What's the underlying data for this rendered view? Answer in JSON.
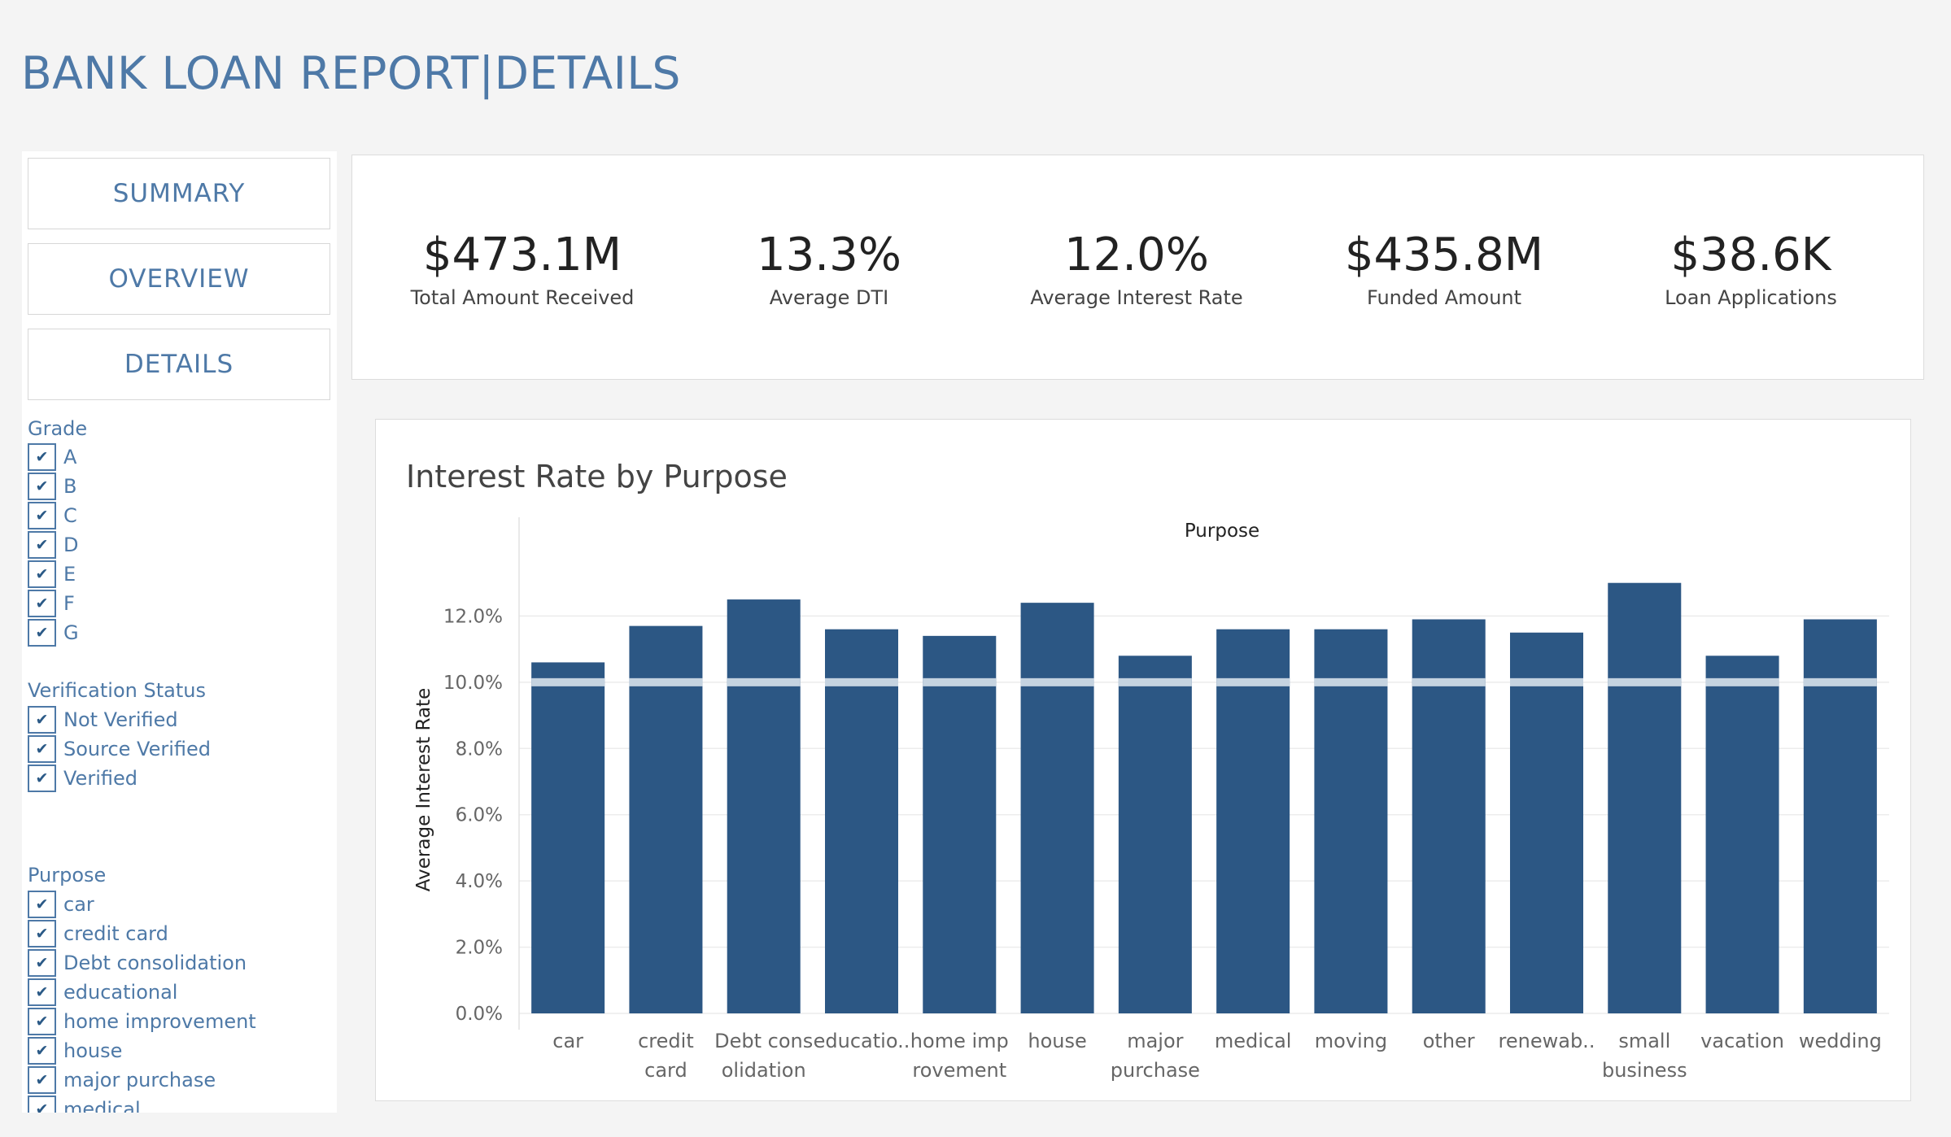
{
  "header": {
    "title": "BANK LOAN REPORT|DETAILS"
  },
  "nav": {
    "summary": "SUMMARY",
    "overview": "OVERVIEW",
    "details": "DETAILS"
  },
  "filters": {
    "grade": {
      "title": "Grade",
      "items": [
        "A",
        "B",
        "C",
        "D",
        "E",
        "F",
        "G"
      ]
    },
    "verification": {
      "title": "Verification Status",
      "items": [
        "Not Verified",
        "Source Verified",
        "Verified"
      ]
    },
    "purpose": {
      "title": "Purpose",
      "items": [
        "car",
        "credit card",
        "Debt consolidation",
        "educational",
        "home improvement",
        "house",
        "major purchase",
        "medical"
      ]
    }
  },
  "kpis": [
    {
      "value": "$473.1M",
      "label": "Total Amount Received"
    },
    {
      "value": "13.3%",
      "label": "Average DTI"
    },
    {
      "value": "12.0%",
      "label": "Average Interest Rate"
    },
    {
      "value": "$435.8M",
      "label": "Funded Amount"
    },
    {
      "value": "$38.6K",
      "label": "Loan Applications"
    }
  ],
  "chart_data": {
    "type": "bar",
    "title": "Interest Rate by Purpose",
    "xlabel": "Purpose",
    "ylabel": "Average Interest Rate",
    "categories": [
      [
        "car"
      ],
      [
        "credit",
        "card"
      ],
      [
        "Debt cons",
        "olidation"
      ],
      [
        "educatio.."
      ],
      [
        "home imp",
        "rovement"
      ],
      [
        "house"
      ],
      [
        "major",
        "purchase"
      ],
      [
        "medical"
      ],
      [
        "moving"
      ],
      [
        "other"
      ],
      [
        "renewab.."
      ],
      [
        "small",
        "business"
      ],
      [
        "vacation"
      ],
      [
        "wedding"
      ]
    ],
    "values": [
      10.6,
      11.7,
      12.5,
      11.6,
      11.4,
      12.4,
      10.8,
      11.6,
      11.6,
      11.9,
      11.5,
      13.0,
      10.8,
      11.9
    ],
    "reference_line": 10.0,
    "ylim": [
      0,
      14
    ],
    "yticks": [
      0,
      2,
      4,
      6,
      8,
      10,
      12
    ],
    "ytick_labels": [
      "0.0%",
      "2.0%",
      "4.0%",
      "6.0%",
      "8.0%",
      "10.0%",
      "12.0%"
    ],
    "bar_color": "#2c5784",
    "reference_color": "#c5d3e0",
    "grid": true
  }
}
